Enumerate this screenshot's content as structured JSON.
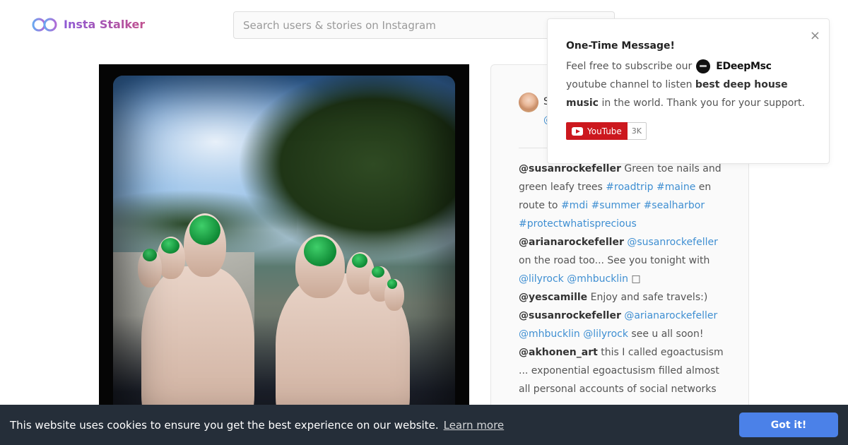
{
  "brand": {
    "name": "Insta Stalker",
    "icon": "glasses-icon"
  },
  "search": {
    "placeholder": "Search users & stories on Instagram",
    "value": ""
  },
  "post": {
    "author_short": "S",
    "author_handle_short": "@",
    "comments": [
      {
        "user": "@susanrockefeller",
        "parts": [
          {
            "t": "text",
            "v": " Green toe nails and green leafy trees "
          },
          {
            "t": "tag",
            "v": "#roadtrip"
          },
          {
            "t": "text",
            "v": " "
          },
          {
            "t": "tag",
            "v": "#maine"
          },
          {
            "t": "text",
            "v": " en route to "
          },
          {
            "t": "tag",
            "v": "#mdi"
          },
          {
            "t": "text",
            "v": " "
          },
          {
            "t": "tag",
            "v": "#summer"
          },
          {
            "t": "text",
            "v": " "
          },
          {
            "t": "tag",
            "v": "#sealharbor"
          },
          {
            "t": "text",
            "v": " "
          },
          {
            "t": "tag",
            "v": "#protectwhatisprecious"
          }
        ]
      },
      {
        "user": "@arianarockefeller",
        "parts": [
          {
            "t": "text",
            "v": " "
          },
          {
            "t": "tag",
            "v": "@susanrockefeller"
          },
          {
            "t": "text",
            "v": " on the road too... See you tonight with "
          },
          {
            "t": "tag",
            "v": "@lilyrock"
          },
          {
            "t": "text",
            "v": " "
          },
          {
            "t": "tag",
            "v": "@mhbucklin"
          },
          {
            "t": "text",
            "v": " □"
          }
        ]
      },
      {
        "user": "@yescamille",
        "parts": [
          {
            "t": "text",
            "v": " Enjoy and safe travels:)"
          }
        ]
      },
      {
        "user": "@susanrockefeller",
        "parts": [
          {
            "t": "text",
            "v": " "
          },
          {
            "t": "tag",
            "v": "@arianarockefeller"
          },
          {
            "t": "text",
            "v": " "
          },
          {
            "t": "tag",
            "v": "@mhbucklin"
          },
          {
            "t": "text",
            "v": " "
          },
          {
            "t": "tag",
            "v": "@lilyrock"
          },
          {
            "t": "text",
            "v": " see u all soon!"
          }
        ]
      },
      {
        "user": "@akhonen_art",
        "parts": [
          {
            "t": "text",
            "v": " this I called egoactusism ... exponential egoactusism filled almost all personal accounts of social networks ..."
          }
        ]
      }
    ]
  },
  "popup": {
    "title": "One-Time Message!",
    "text_before": "Feel free to subscribe our",
    "channel_name": "EDeepMsc",
    "text_mid": "youtube channel to listen",
    "text_bold": "best deep house music",
    "text_after": "in the world. Thank you for your support.",
    "yt_label": "YouTube",
    "yt_count": "3K",
    "close": "×"
  },
  "cookie": {
    "message": "This website uses cookies to ensure you get the best experience on our website.",
    "link": "Learn more",
    "button": "Got it!"
  },
  "colors": {
    "accent": "#4b81e8",
    "link": "#3f8fd2",
    "brand": "#9b59b6",
    "cookie_bg": "#252e39",
    "youtube": "#cc181e"
  }
}
